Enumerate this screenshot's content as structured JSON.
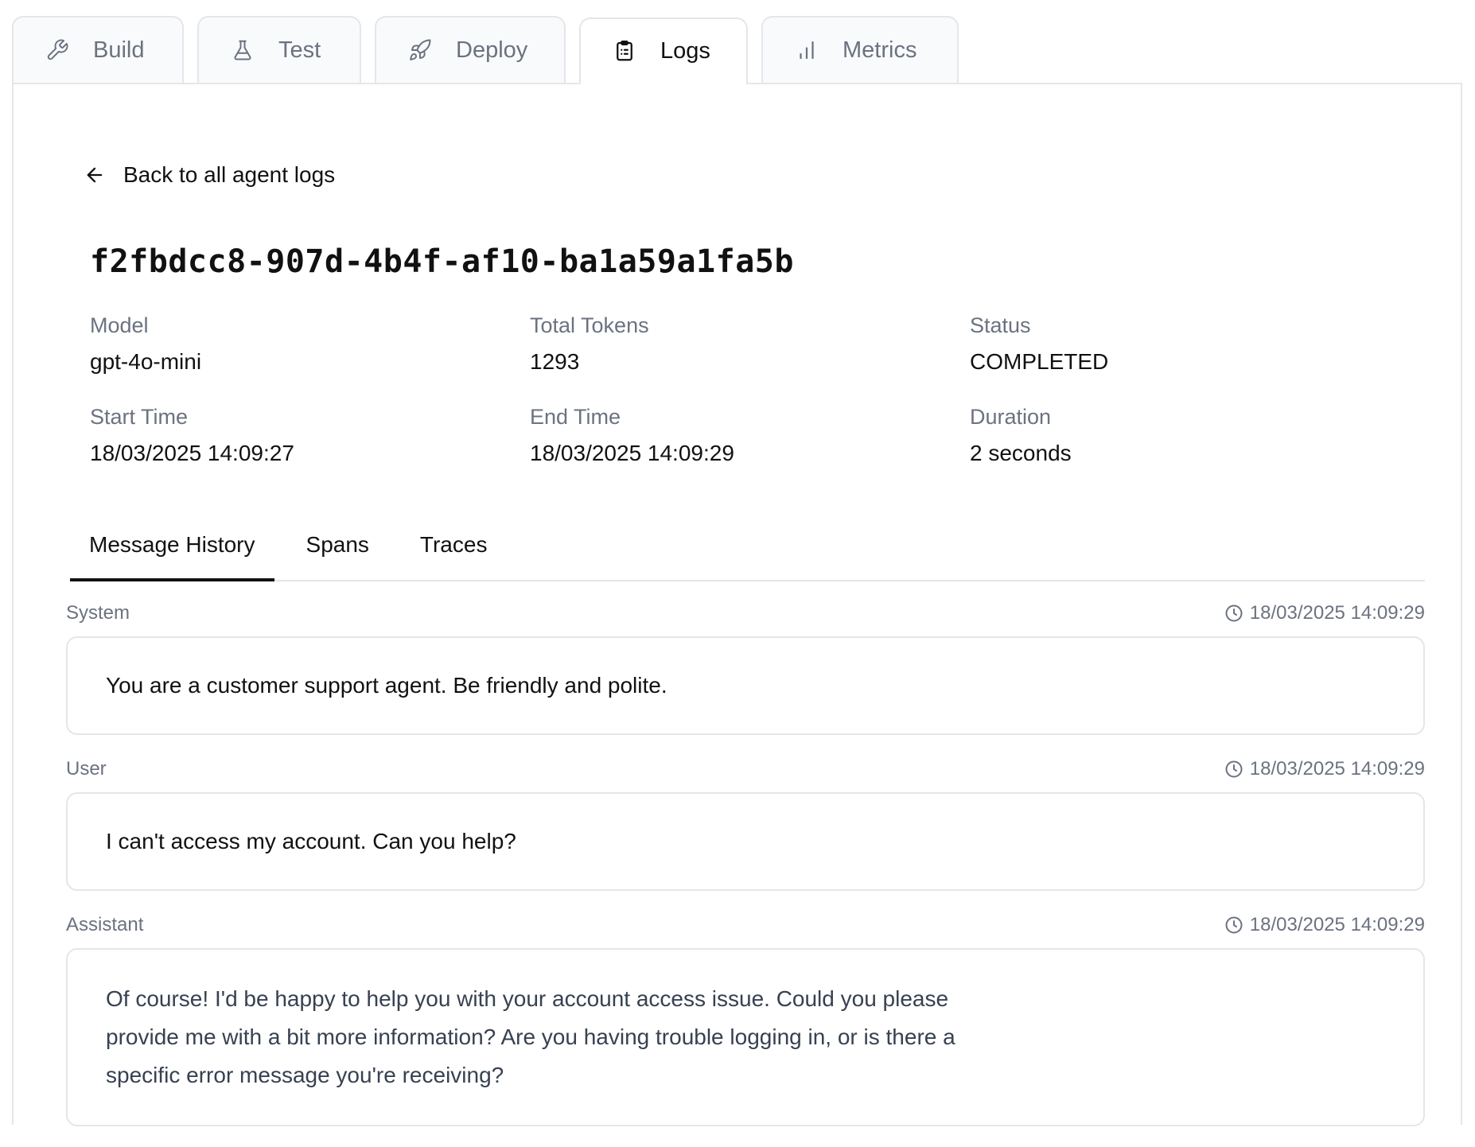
{
  "tabs": [
    {
      "id": "build",
      "label": "Build",
      "icon": "wrench-icon"
    },
    {
      "id": "test",
      "label": "Test",
      "icon": "flask-icon"
    },
    {
      "id": "deploy",
      "label": "Deploy",
      "icon": "rocket-icon"
    },
    {
      "id": "logs",
      "label": "Logs",
      "icon": "clipboard-icon",
      "active": true
    },
    {
      "id": "metrics",
      "label": "Metrics",
      "icon": "bar-chart-icon"
    }
  ],
  "back_link": {
    "label": "Back to all agent logs",
    "icon": "arrow-left-icon"
  },
  "log": {
    "id": "f2fbdcc8-907d-4b4f-af10-ba1a59a1fa5b",
    "model": {
      "label": "Model",
      "value": "gpt-4o-mini"
    },
    "total_tokens": {
      "label": "Total Tokens",
      "value": "1293"
    },
    "status": {
      "label": "Status",
      "value": "COMPLETED"
    },
    "start_time": {
      "label": "Start Time",
      "value": "18/03/2025 14:09:27"
    },
    "end_time": {
      "label": "End Time",
      "value": "18/03/2025 14:09:29"
    },
    "duration": {
      "label": "Duration",
      "value": "2 seconds"
    }
  },
  "subtabs": [
    {
      "label": "Message History",
      "active": true
    },
    {
      "label": "Spans"
    },
    {
      "label": "Traces"
    }
  ],
  "messages": [
    {
      "role": "System",
      "timestamp": "18/03/2025 14:09:29",
      "content": "You are a customer support agent. Be friendly and polite."
    },
    {
      "role": "User",
      "timestamp": "18/03/2025 14:09:29",
      "content": "I can't access my account. Can you help?"
    },
    {
      "role": "Assistant",
      "timestamp": "18/03/2025 14:09:29",
      "content": "Of course! I'd be happy to help you with your account access issue. Could you please provide me with a bit more information? Are you having trouble logging in, or is there a specific error message you're receiving?"
    }
  ],
  "colors": {
    "border": "#e4e6ea",
    "muted_text": "#6b7280",
    "text": "#111111",
    "inactive_tab_bg": "#f9fafb"
  }
}
